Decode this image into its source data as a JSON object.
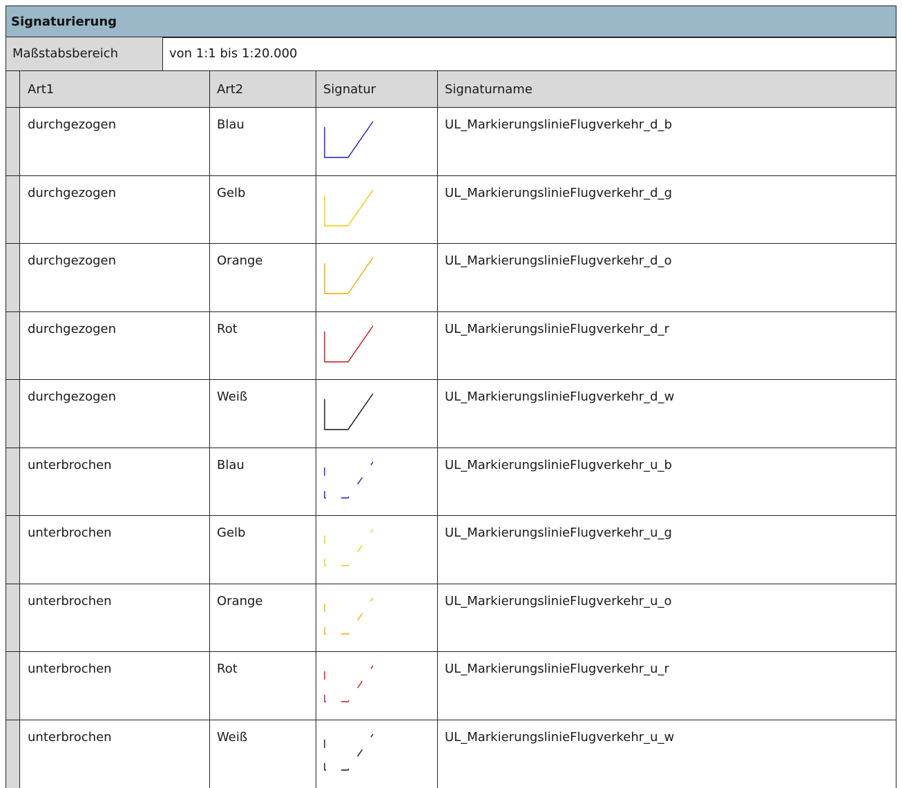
{
  "title": "Signaturierung",
  "scale": {
    "label": "Maßstabsbereich",
    "value": "von 1:1 bis 1:20.000"
  },
  "columns": {
    "art1": "Art1",
    "art2": "Art2",
    "signatur": "Signatur",
    "signaturname": "Signaturname"
  },
  "rows": [
    {
      "art1": "durchgezogen",
      "art2": "Blau",
      "line_style": "solid",
      "color": "#1a1acc",
      "signaturname": "UL_MarkierungslinieFlugverkehr_d_b"
    },
    {
      "art1": "durchgezogen",
      "art2": "Gelb",
      "line_style": "solid",
      "color": "#f5c800",
      "signaturname": "UL_MarkierungslinieFlugverkehr_d_g"
    },
    {
      "art1": "durchgezogen",
      "art2": "Orange",
      "line_style": "solid",
      "color": "#f0a800",
      "signaturname": "UL_MarkierungslinieFlugverkehr_d_o"
    },
    {
      "art1": "durchgezogen",
      "art2": "Rot",
      "line_style": "solid",
      "color": "#cc1111",
      "signaturname": "UL_MarkierungslinieFlugverkehr_d_r"
    },
    {
      "art1": "durchgezogen",
      "art2": "Weiß",
      "line_style": "solid",
      "color": "#111111",
      "signaturname": "UL_MarkierungslinieFlugverkehr_d_w"
    },
    {
      "art1": "unterbrochen",
      "art2": "Blau",
      "line_style": "dashed",
      "color": "#1a1acc",
      "signaturname": "UL_MarkierungslinieFlugverkehr_u_b"
    },
    {
      "art1": "unterbrochen",
      "art2": "Gelb",
      "line_style": "dashed",
      "color": "#f5c800",
      "signaturname": "UL_MarkierungslinieFlugverkehr_u_g"
    },
    {
      "art1": "unterbrochen",
      "art2": "Orange",
      "line_style": "dashed",
      "color": "#f0a800",
      "signaturname": "UL_MarkierungslinieFlugverkehr_u_o"
    },
    {
      "art1": "unterbrochen",
      "art2": "Rot",
      "line_style": "dashed",
      "color": "#cc1111",
      "signaturname": "UL_MarkierungslinieFlugverkehr_u_r"
    },
    {
      "art1": "unterbrochen",
      "art2": "Weiß",
      "line_style": "dashed",
      "color": "#111111",
      "signaturname": "UL_MarkierungslinieFlugverkehr_u_w"
    }
  ]
}
